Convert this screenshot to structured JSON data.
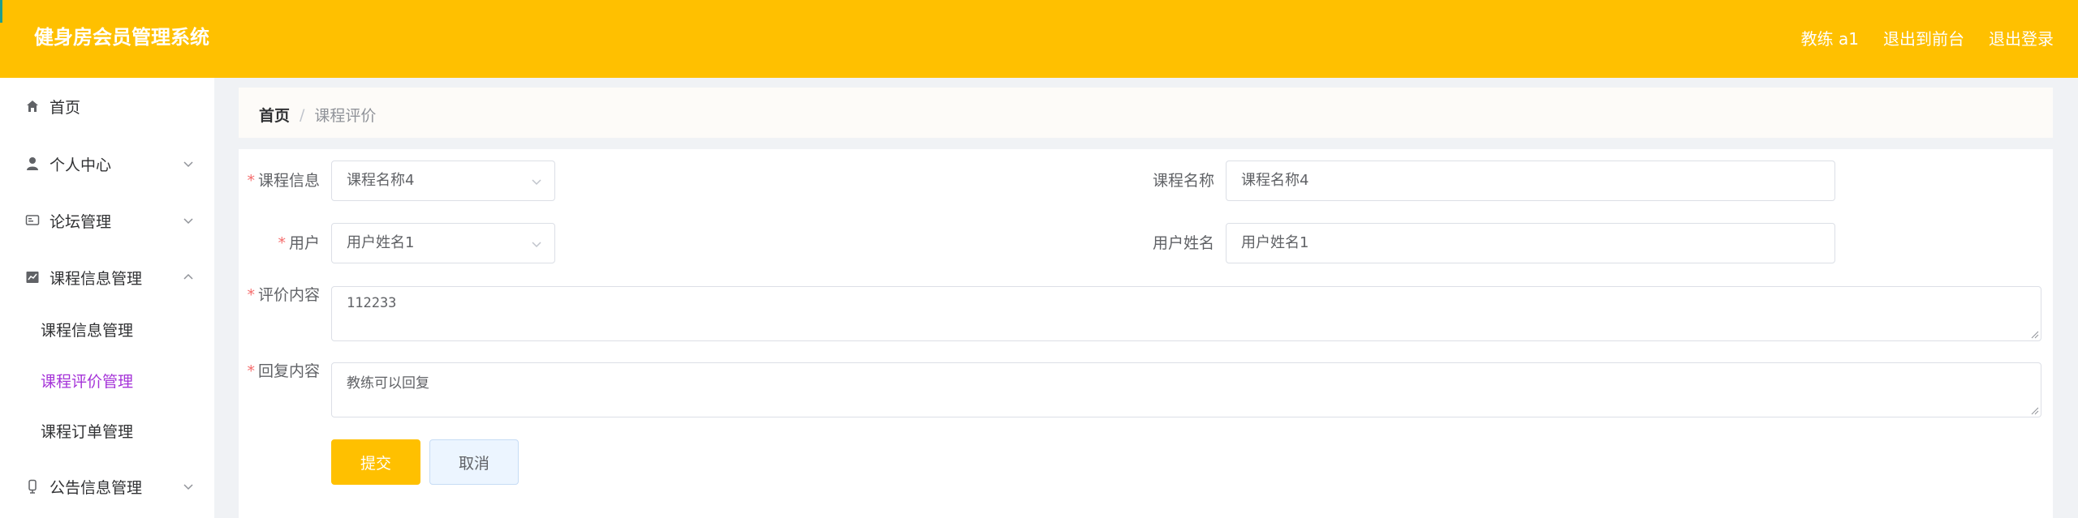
{
  "header": {
    "title": "健身房会员管理系统",
    "user": "教练 a1",
    "front_link": "退出到前台",
    "logout": "退出登录",
    "bg_color": "#ffc000"
  },
  "sidebar": {
    "items": [
      {
        "label": "首页",
        "icon": "home-icon"
      },
      {
        "label": "个人中心",
        "icon": "user-icon"
      },
      {
        "label": "论坛管理",
        "icon": "forum-icon"
      },
      {
        "label": "课程信息管理",
        "icon": "chart-icon"
      },
      {
        "label": "公告信息管理",
        "icon": "announce-icon"
      }
    ],
    "subitems": [
      {
        "label": "课程信息管理"
      },
      {
        "label": "课程评价管理"
      },
      {
        "label": "课程订单管理"
      }
    ],
    "active_color": "#a533d8"
  },
  "breadcrumb": {
    "home": "首页",
    "separator": "/",
    "current": "课程评价"
  },
  "form": {
    "course_info_label": "课程信息",
    "course_info_value": "课程名称4",
    "course_name_label": "课程名称",
    "course_name_value": "课程名称4",
    "user_label": "用户",
    "user_value": "用户姓名1",
    "user_name_label": "用户姓名",
    "user_name_value": "用户姓名1",
    "review_label": "评价内容",
    "review_value": "112233",
    "reply_label": "回复内容",
    "reply_value": "教练可以回复",
    "required_mark": "*"
  },
  "buttons": {
    "submit": "提交",
    "cancel": "取消"
  }
}
